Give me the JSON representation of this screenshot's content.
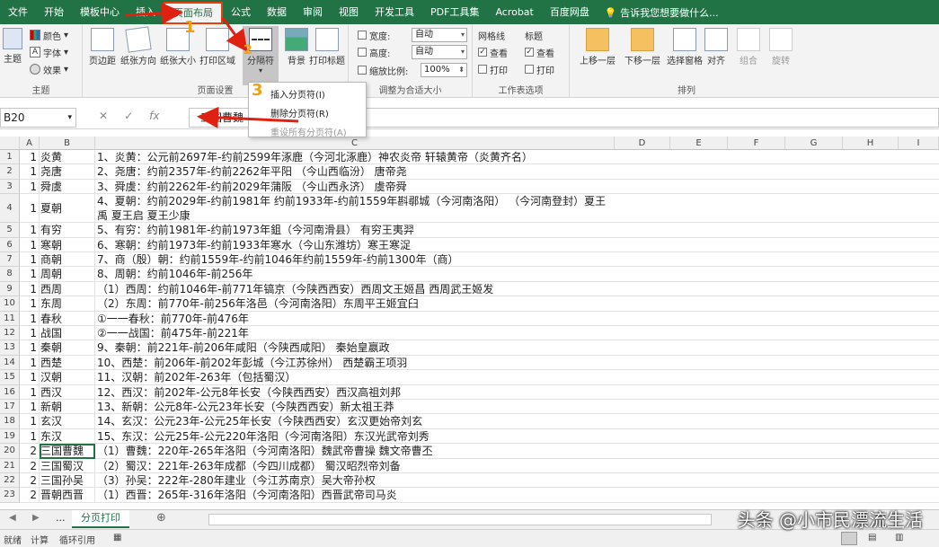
{
  "menu": {
    "tabs": [
      "文件",
      "开始",
      "模板中心",
      "插入",
      "页面布局",
      "公式",
      "数据",
      "审阅",
      "视图",
      "开发工具",
      "PDF工具集",
      "Acrobat",
      "百度网盘"
    ],
    "active": "页面布局",
    "tell_me": "告诉我您想要做什么..."
  },
  "ribbon": {
    "theme": {
      "big": "主题",
      "colors": "颜色",
      "fonts": "字体",
      "effects": "效果",
      "group": "主题"
    },
    "page_setup": {
      "margins": "页边距",
      "orientation": "纸张方向",
      "size": "纸张大小",
      "print_area": "打印区域",
      "breaks": "分隔符",
      "background": "背景",
      "print_titles": "打印标题",
      "group": "页面设置"
    },
    "scale": {
      "width_label": "宽度:",
      "width_value": "自动",
      "height_label": "高度:",
      "height_value": "自动",
      "scale_label": "缩放比例:",
      "scale_value": "100%",
      "group": "调整为合适大小"
    },
    "sheet_options": {
      "gridlines": "网格线",
      "headings": "标题",
      "view": "查看",
      "print": "打印",
      "group": "工作表选项"
    },
    "arrange": {
      "forward": "上移一层",
      "backward": "下移一层",
      "selection": "选择窗格",
      "align": "对齐",
      "group_btn": "组合",
      "rotate": "旋转",
      "group": "排列"
    }
  },
  "dropdown": {
    "insert": "插入分页符(I)",
    "remove": "删除分页符(R)",
    "reset": "重设所有分页符(A)"
  },
  "annotations": {
    "n1": "1",
    "n2": "2",
    "n3": "3"
  },
  "formula": {
    "name_box": "B20",
    "content": "三国曹魏"
  },
  "columns": [
    "A",
    "B",
    "C",
    "D",
    "E",
    "F",
    "G",
    "H",
    "I"
  ],
  "rows": [
    {
      "n": "1",
      "a": "1",
      "b": "炎黄",
      "c": "1、炎黄：公元前2697年-约前2599年涿鹿（今河北涿鹿）神农炎帝 轩辕黄帝（炎黄齐名）"
    },
    {
      "n": "2",
      "a": "1",
      "b": "尧唐",
      "c": "2、尧唐：约前2357年-约前2262年平阳 （今山西临汾） 唐帝尧"
    },
    {
      "n": "3",
      "a": "1",
      "b": "舜虞",
      "c": "3、舜虞：约前2262年-约前2029年蒲阪 （今山西永济） 虞帝舜"
    },
    {
      "n": "4",
      "a": "1",
      "b": "夏朝",
      "c": "4、夏朝：约前2029年-约前1981年 约前1933年-约前1559年斟鄩城（今河南洛阳） （今河南登封）夏王禹 夏王启 夏王少康"
    },
    {
      "n": "5",
      "a": "1",
      "b": "有穷",
      "c": "5、有穷：约前1981年-约前1973年鉏（今河南滑县） 有穷王夷羿"
    },
    {
      "n": "6",
      "a": "1",
      "b": "寒朝",
      "c": "6、寒朝：约前1973年-约前1933年寒水（今山东潍坊）寒王寒浞"
    },
    {
      "n": "7",
      "a": "1",
      "b": "商朝",
      "c": "7、商（殷）朝：约前1559年-约前1046年约前1559年-约前1300年（商）"
    },
    {
      "n": "8",
      "a": "1",
      "b": "周朝",
      "c": "8、周朝：约前1046年-前256年"
    },
    {
      "n": "9",
      "a": "1",
      "b": "西周",
      "c": "（1）西周：约前1046年-前771年镐京（今陕西西安）西周文王姬昌 西周武王姬发"
    },
    {
      "n": "10",
      "a": "1",
      "b": "东周",
      "c": "（2）东周：前770年-前256年洛邑（今河南洛阳）东周平王姬宜臼"
    },
    {
      "n": "11",
      "a": "1",
      "b": "春秋",
      "c": "①一一春秋：前770年-前476年"
    },
    {
      "n": "12",
      "a": "1",
      "b": "战国",
      "c": "②一一战国：前475年-前221年"
    },
    {
      "n": "13",
      "a": "1",
      "b": "秦朝",
      "c": "9、秦朝：前221年-前206年咸阳（今陕西咸阳） 秦始皇嬴政"
    },
    {
      "n": "14",
      "a": "1",
      "b": "西楚",
      "c": "10、西楚：前206年-前202年彭城（今江苏徐州） 西楚霸王项羽"
    },
    {
      "n": "15",
      "a": "1",
      "b": "汉朝",
      "c": "11、汉朝：前202年-263年（包括蜀汉）"
    },
    {
      "n": "16",
      "a": "1",
      "b": "西汉",
      "c": "12、西汉：前202年-公元8年长安（今陕西西安）西汉高祖刘邦"
    },
    {
      "n": "17",
      "a": "1",
      "b": "新朝",
      "c": "13、新朝：公元8年-公元23年长安（今陕西西安）新太祖王莽"
    },
    {
      "n": "18",
      "a": "1",
      "b": "玄汉",
      "c": "14、玄汉：公元23年-公元25年长安（今陕西西安）玄汉更始帝刘玄"
    },
    {
      "n": "19",
      "a": "1",
      "b": "东汉",
      "c": "15、东汉：公元25年-公元220年洛阳（今河南洛阳）东汉光武帝刘秀"
    },
    {
      "n": "20",
      "a": "2",
      "b": "三国曹魏",
      "c": "（1）曹魏：220年-265年洛阳（今河南洛阳）魏武帝曹操 魏文帝曹丕"
    },
    {
      "n": "21",
      "a": "2",
      "b": "三国蜀汉",
      "c": "（2）蜀汉：221年-263年成都（今四川成都） 蜀汉昭烈帝刘备"
    },
    {
      "n": "22",
      "a": "2",
      "b": "三国孙吴",
      "c": "（3）孙吴：222年-280年建业（今江苏南京）吴大帝孙权"
    },
    {
      "n": "23",
      "a": "2",
      "b": "晋朝西晋",
      "c": "（1）西晋：265年-316年洛阳（今河南洛阳）西晋武帝司马炎"
    }
  ],
  "sheet": {
    "ellipsis": "...",
    "tab": "分页打印"
  },
  "status": {
    "ready": "就绪",
    "calc": "计算",
    "circ": "循环引用"
  },
  "watermark": "头条 @小市民漂流生活"
}
